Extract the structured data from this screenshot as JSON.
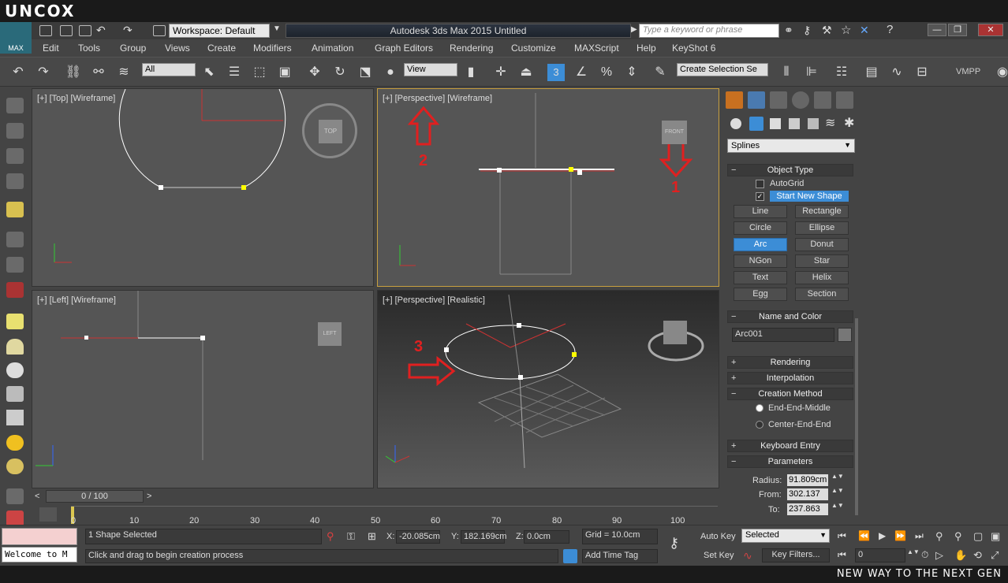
{
  "brand": {
    "logo": "UNCOX"
  },
  "title": {
    "workspace": "Workspace: Default",
    "app_title": "Autodesk 3ds Max  2015     Untitled",
    "search_placeholder": "Type a keyword or phrase",
    "max_button": "MAX"
  },
  "menu": [
    "Edit",
    "Tools",
    "Group",
    "Views",
    "Create",
    "Modifiers",
    "Animation",
    "Graph Editors",
    "Rendering",
    "Customize",
    "MAXScript",
    "Help",
    "KeyShot 6"
  ],
  "toolbar": {
    "filter": "All",
    "refcoord": "View",
    "snap_label": "3",
    "selection_set": "Create Selection Se",
    "vmpp": "VMPP"
  },
  "viewports": {
    "top": "[+] [Top] [Wireframe]",
    "persp1": "[+] [Perspective] [Wireframe]",
    "left": "[+] [Left] [Wireframe]",
    "persp2": "[+] [Perspective] [Realistic]",
    "cube_top": "TOP",
    "cube_front": "FRONT",
    "cube_left": "LEFT"
  },
  "annotations": [
    "1",
    "2",
    "3"
  ],
  "panel": {
    "category": "Splines",
    "object_type_header": "Object Type",
    "autogrid": "AutoGrid",
    "start_new_shape": "Start New Shape",
    "buttons": [
      [
        "Line",
        "Rectangle"
      ],
      [
        "Circle",
        "Ellipse"
      ],
      [
        "Arc",
        "Donut"
      ],
      [
        "NGon",
        "Star"
      ],
      [
        "Text",
        "Helix"
      ],
      [
        "Egg",
        "Section"
      ]
    ],
    "active_button": "Arc",
    "name_color_header": "Name and Color",
    "name": "Arc001",
    "rendering": "Rendering",
    "interpolation": "Interpolation",
    "creation_method": "Creation Method",
    "cm_options": [
      "End-End-Middle",
      "Center-End-End"
    ],
    "keyboard_entry": "Keyboard Entry",
    "parameters": "Parameters",
    "radius_label": "Radius:",
    "radius": "91.809cm",
    "from_label": "From:",
    "from": "302.137",
    "to_label": "To:",
    "to": "237.863"
  },
  "timeline": {
    "frame": "0 / 100",
    "ticks": [
      "0",
      "10",
      "20",
      "30",
      "40",
      "50",
      "60",
      "70",
      "80",
      "90",
      "100"
    ]
  },
  "status": {
    "welcome": "Welcome to M",
    "selected": "1 Shape Selected",
    "prompt": "Click and drag to begin creation process",
    "x_label": "X:",
    "x": "-20.085cm",
    "y_label": "Y:",
    "y": "182.169cm",
    "z_label": "Z:",
    "z": "0.0cm",
    "grid": "Grid = 10.0cm",
    "add_time_tag": "Add Time Tag",
    "auto_key": "Auto Key",
    "set_key": "Set Key",
    "key_mode": "Selected",
    "key_filters": "Key Filters...",
    "frame_field": "0"
  },
  "footer": {
    "tagline": "NEW WAY TO THE NEXT GEN"
  }
}
